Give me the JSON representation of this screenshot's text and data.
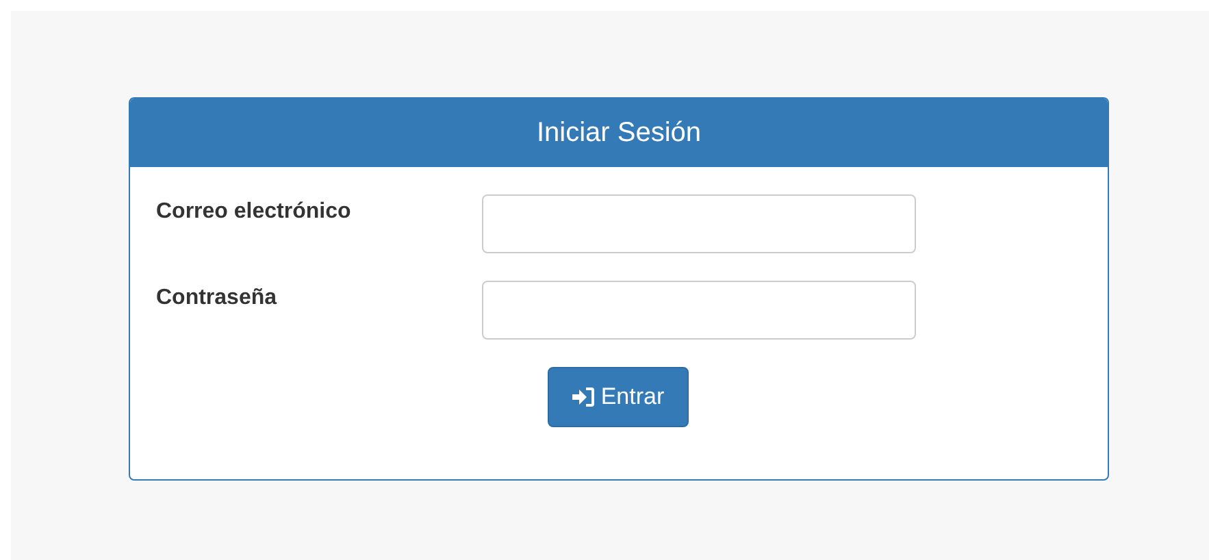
{
  "panel": {
    "title": "Iniciar Sesión"
  },
  "fields": [
    {
      "label": "Correo electrónico"
    },
    {
      "label": "Contraseña"
    }
  ],
  "submit": {
    "label": "Entrar"
  }
}
